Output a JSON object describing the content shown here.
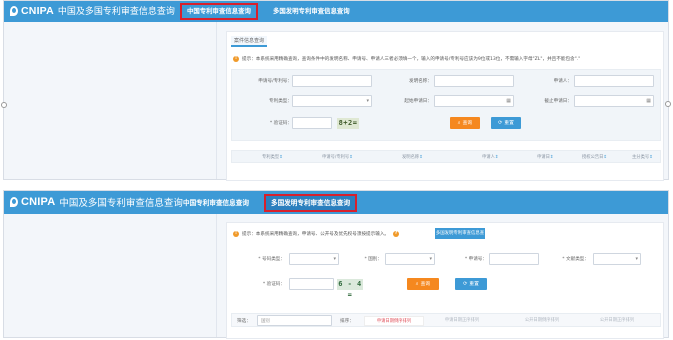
{
  "screen1": {
    "brand": "CNIPA",
    "brand_sub": "中国及多国专利审查信息查询",
    "nav": [
      "中国专利审查信息查询",
      "多国发明专利审查信息查询"
    ],
    "subtab": "案件信息查询",
    "hint": "提示：本系统采用精确查询，查询条件中的发明名称、申请号、申请人三者必须填一个，输入的申请号/专利号应该为9位或13位，不需输入字母\"ZL\"，并且不能包含\".\"",
    "form": {
      "app_no_label": "申请号/专利号：",
      "invention_name_label": "发明名称：",
      "applicant_label": "申请人：",
      "patent_type_label": "专利类型：",
      "start_date_label": "起始申请日：",
      "end_date_label": "截止申请日：",
      "captcha_label": "* 验证码：",
      "captcha_text": "8+2=",
      "query_button": "查询",
      "reset_button": "重置"
    },
    "table_headers": [
      "专利类型",
      "申请号/专利号",
      "发明名称",
      "申请人",
      "申请日",
      "授权公告日",
      "主分类号"
    ]
  },
  "screen2": {
    "brand": "CNIPA",
    "brand_sub": "中国及多国专利审查信息查询",
    "nav": [
      "中国专利审查信息查询",
      "多国发明专利审查信息查询"
    ],
    "hint": "提示：本系统采用精确查询，申请号、公开号及优先权号须按提示输入。",
    "manual_button": "多国发明专利审查信息查询使用手册",
    "form": {
      "number_type_label": "* 号码类型：",
      "country_label": "* 国别：",
      "number_label": "* 申请号：",
      "doc_type_label": "* 文献类型：",
      "captcha_label": "* 验证码：",
      "captcha_text": "6 - 4 =",
      "query_button": "查询",
      "reset_button": "重置"
    },
    "filter_label": "筛选：",
    "filter_placeholder": "国别",
    "sort_label": "排序：",
    "sort_tabs": [
      "申请日期倒序排列",
      "申请日期正序排列",
      "公开日期倒序排列",
      "公开日期正序排列"
    ]
  }
}
